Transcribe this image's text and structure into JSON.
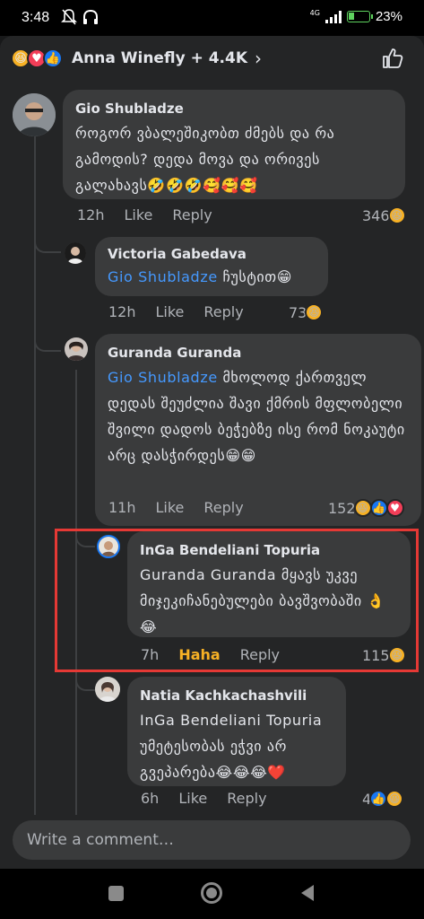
{
  "status_bar": {
    "time": "3:48",
    "network": "4G",
    "battery": "23%"
  },
  "header": {
    "reactor_names": "Anna Winefly + 4.4K",
    "reactions": [
      "haha",
      "love",
      "like"
    ]
  },
  "comments": [
    {
      "author": "Gio Shubladze",
      "text": "როგორ ვბალეშიკობთ ძმებს და რა გამოდის? დედა მოვა და ორივეს გალახავს🤣🤣🤣🥰🥰🥰",
      "time": "12h",
      "like_label": "Like",
      "reply_label": "Reply",
      "reaction_count": "346",
      "reactions": [
        "haha"
      ]
    },
    {
      "author": "Victoria Gabedava",
      "mention": "Gio Shubladze",
      "text": " ჩუსტით😁",
      "time": "12h",
      "like_label": "Like",
      "reply_label": "Reply",
      "reaction_count": "73",
      "reactions": [
        "haha"
      ]
    },
    {
      "author": "Guranda Guranda",
      "mention": "Gio Shubladze",
      "text": " მხოლოდ ქართველ დედას შეუძლია შავი ქმრის მფლობელი შვილი დადოს ბეჭებზე  ისე რომ ნოკაუტი არც დასჭირდეს😁😁",
      "time": "11h",
      "like_label": "Like",
      "reply_label": "Reply",
      "reaction_count": "152",
      "reactions": [
        "haha",
        "like",
        "love"
      ]
    },
    {
      "author": "InGa Bendeliani Topuria",
      "text": "Guranda Guranda  მყავს უკვე მიჯეკიჩანებულები ბავშვობაში 👌😂",
      "time": "7h",
      "like_label": "Haha",
      "reply_label": "Reply",
      "reaction_count": "115",
      "reactions": [
        "haha"
      ]
    },
    {
      "author": "Natia Kachkachashvili",
      "text": "InGa Bendeliani Topuria უმეტესობას ეჭვი არ გვეპარება😂😂😂❤️",
      "time": "6h",
      "like_label": "Like",
      "reply_label": "Reply",
      "reaction_count": "4",
      "reactions": [
        "like",
        "haha"
      ]
    }
  ],
  "composer": {
    "placeholder": "Write a comment…"
  },
  "colors": {
    "background": "#242526",
    "bubble": "#3a3b3c",
    "mention": "#4599ff",
    "haha": "#f7b125",
    "highlight": "#e53935"
  }
}
